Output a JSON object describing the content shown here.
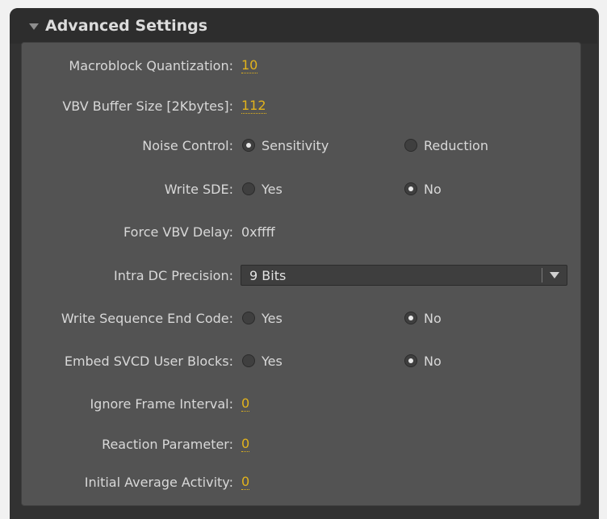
{
  "panel": {
    "title": "Advanced Settings"
  },
  "settings": {
    "macroblock_quantization": {
      "label": "Macroblock Quantization:",
      "value": "10"
    },
    "vbv_buffer_size": {
      "label": "VBV Buffer Size [2Kbytes]:",
      "value": "112"
    },
    "noise_control": {
      "label": "Noise Control:",
      "option_a": "Sensitivity",
      "option_b": "Reduction",
      "selected": "Sensitivity"
    },
    "write_sde": {
      "label": "Write SDE:",
      "option_a": "Yes",
      "option_b": "No",
      "selected": "No"
    },
    "force_vbv_delay": {
      "label": "Force VBV Delay:",
      "value": "0xffff"
    },
    "intra_dc_precision": {
      "label": "Intra DC Precision:",
      "value": "9 Bits"
    },
    "write_sequence_end_code": {
      "label": "Write Sequence End Code:",
      "option_a": "Yes",
      "option_b": "No",
      "selected": "No"
    },
    "embed_svcd_user_blocks": {
      "label": "Embed SVCD User Blocks:",
      "option_a": "Yes",
      "option_b": "No",
      "selected": "No"
    },
    "ignore_frame_interval": {
      "label": "Ignore Frame Interval:",
      "value": "0"
    },
    "reaction_parameter": {
      "label": "Reaction Parameter:",
      "value": "0"
    },
    "initial_average_activity": {
      "label": "Initial Average Activity:",
      "value": "0"
    }
  },
  "colors": {
    "background": "#535353",
    "accent_link": "#e2b31c",
    "text": "#d8d8d8"
  }
}
